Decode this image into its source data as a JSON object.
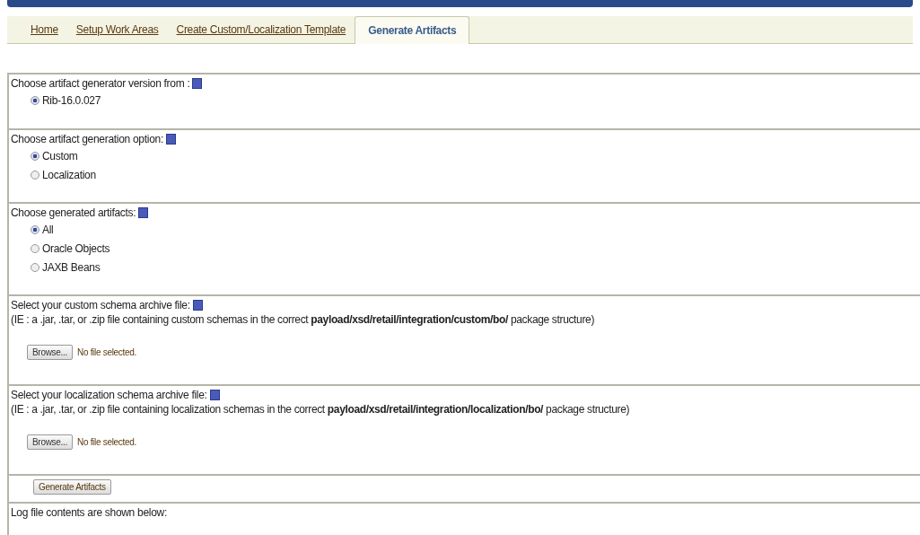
{
  "tabs": [
    {
      "label": "Home",
      "selected": false
    },
    {
      "label": "Setup Work Areas",
      "selected": false
    },
    {
      "label": "Create Custom/Localization Template",
      "selected": false
    },
    {
      "label": "Generate Artifacts",
      "selected": true
    }
  ],
  "sections": [
    {
      "kind": "radio",
      "label": "Choose artifact generator version from :",
      "options": [
        {
          "label": "Rib-16.0.027",
          "selected": true
        }
      ]
    },
    {
      "kind": "radio",
      "label": "Choose artifact generation option:",
      "options": [
        {
          "label": "Custom",
          "selected": true
        },
        {
          "label": "Localization",
          "selected": false
        }
      ]
    },
    {
      "kind": "radio",
      "label": "Choose generated artifacts:",
      "options": [
        {
          "label": "All",
          "selected": true
        },
        {
          "label": "Oracle Objects",
          "selected": false
        },
        {
          "label": "JAXB Beans",
          "selected": false
        }
      ]
    },
    {
      "kind": "file",
      "label": "Select your custom schema archive file:",
      "hint": "(IE : a .jar, .tar, or .zip file containing custom schemas in the correct **payload/xsd/retail/integration/custom/bo/** package structure)",
      "button": "Browse...",
      "status": "No file selected."
    },
    {
      "kind": "file",
      "label": "Select your localization schema archive file:",
      "hint": "(IE : a .jar, .tar, or .zip file containing localization schemas in the correct **payload/xsd/retail/integration/localization/bo/** package structure)",
      "button": "Browse...",
      "status": "No file selected."
    },
    {
      "kind": "action",
      "button": "Generate Artifacts"
    },
    {
      "kind": "log",
      "label": "Log file contents are shown below:"
    }
  ]
}
